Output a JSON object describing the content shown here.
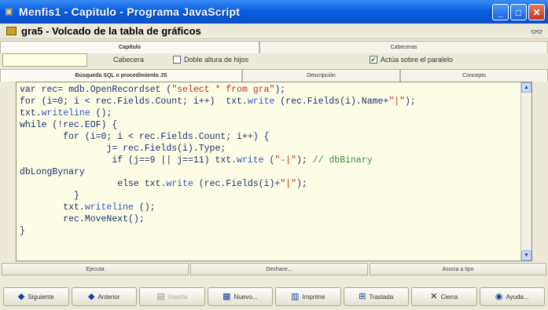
{
  "window": {
    "title": "Menfis1 - Capitulo - Programa JavaScript"
  },
  "header": {
    "heading": "gra5 - Volcado de la tabla de gráficos"
  },
  "tabs_top": [
    "Capítulo",
    "Cabeceras"
  ],
  "options": {
    "title_value": "",
    "cabecera_label": "Cabecera",
    "double_height_label": "Doble altura de hijos",
    "double_height_checked": false,
    "parallel_label": "Actúa sobre el paralelo",
    "parallel_checked": true
  },
  "tabs_main": [
    "Búsqueda SQL o procedimiento JS",
    "Descripción",
    "Concepto"
  ],
  "code": {
    "lines": [
      "var rec= mdb.OpenRecordset (\"select * from gra\");",
      "for (i=0; i < rec.Fields.Count; i++)  txt.write (rec.Fields(i).Name+\"|\");",
      "txt.writeline ();",
      "while (!rec.EOF) {",
      "        for (i=0; i < rec.Fields.Count; i++) {",
      "                j= rec.Fields(i).Type;",
      "                 if (j==9 || j==11) txt.write (\"-|\"); // dbBinary",
      "dbLongBynary",
      "                  else txt.write (rec.Fields(i)+\"|\");",
      "          }",
      "        txt.writeline ();",
      "        rec.MoveNext();",
      "}"
    ]
  },
  "code_actions": [
    "Ejecuta",
    "Deshace...",
    "Asocia a tipo"
  ],
  "toolbar": [
    {
      "label": "Siguiente",
      "icon": "right-arrow-icon",
      "enabled": true
    },
    {
      "label": "Anterior",
      "icon": "left-arrow-icon",
      "enabled": true
    },
    {
      "label": "Inserta",
      "icon": "insert-icon",
      "enabled": false
    },
    {
      "label": "Nuevo...",
      "icon": "new-icon",
      "enabled": true
    },
    {
      "label": "Imprime",
      "icon": "printer-icon",
      "enabled": true
    },
    {
      "label": "Traslada",
      "icon": "move-icon",
      "enabled": true
    },
    {
      "label": "Cierra",
      "icon": "close-icon",
      "enabled": true
    },
    {
      "label": "Ayuda...",
      "icon": "help-icon",
      "enabled": true
    }
  ]
}
